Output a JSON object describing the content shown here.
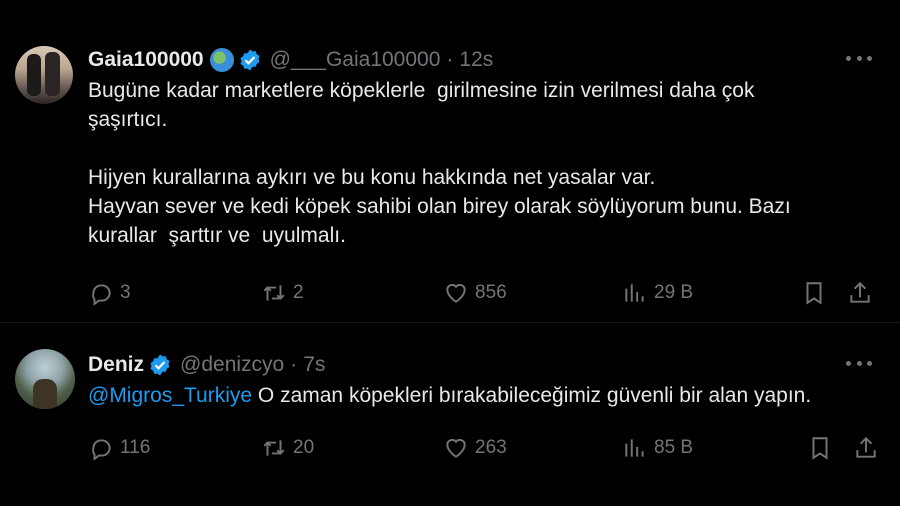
{
  "tweets": [
    {
      "name": "Gaia100000",
      "handle": "@___Gaia100000",
      "time": "12s",
      "line1": "Bugüne kadar marketlere köpeklerle  girilmesine izin verilmesi daha çok",
      "line2": "şaşırtıcı.",
      "line3": "",
      "line4": "Hijyen kurallarına aykırı ve bu konu hakkında net yasalar var.",
      "line5": "Hayvan sever ve kedi köpek sahibi olan birey olarak söylüyorum bunu. Bazı",
      "line6": "kurallar  şarttır ve  uyulmalı.",
      "replies": "3",
      "retweets": "2",
      "likes": "856",
      "views": "29 B"
    },
    {
      "name": "Deniz",
      "handle": "@denizcyo",
      "time": "7s",
      "mention": "@Migros_Turkiye",
      "text": " O zaman köpekleri bırakabileceğimiz güvenli bir alan yapın.",
      "replies": "116",
      "retweets": "20",
      "likes": "263",
      "views": "85 B"
    }
  ],
  "colors": {
    "background": "#000000",
    "text": "#e7e9ea",
    "muted": "#71767b",
    "accent": "#1d9bf0"
  },
  "icons": [
    "globe-icon",
    "verified-badge-icon",
    "more-icon",
    "reply-icon",
    "retweet-icon",
    "like-icon",
    "views-icon",
    "bookmark-icon",
    "share-icon"
  ]
}
